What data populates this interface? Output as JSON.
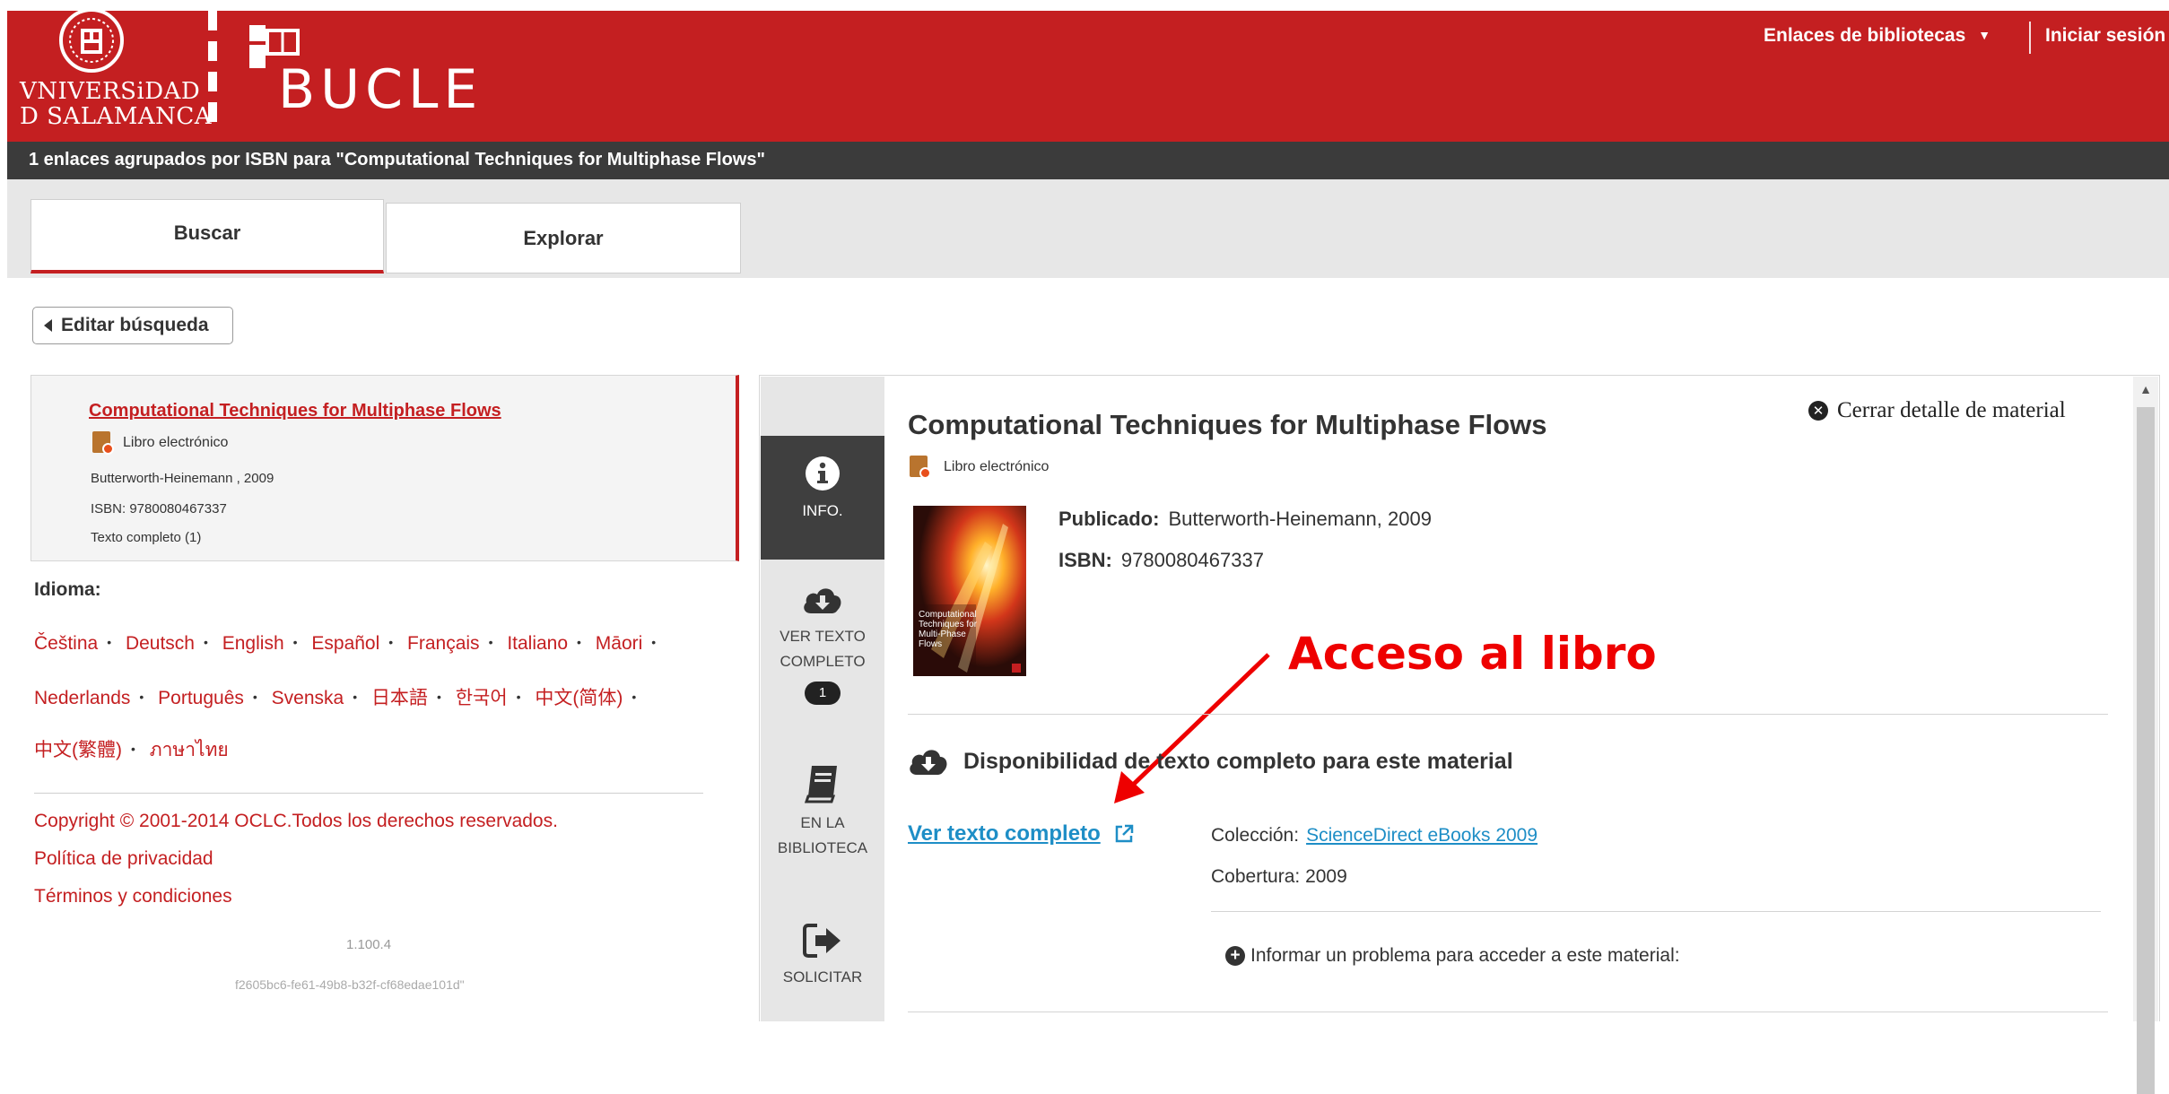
{
  "header": {
    "university_logo_text": [
      "VNIVERSiDAD",
      "D SALAMANCA"
    ],
    "app_name": "BUCLE",
    "links_menu_label": "Enlaces de bibliotecas",
    "login_label": "Iniciar sesión"
  },
  "results_bar": {
    "text": "1 enlaces agrupados por ISBN para \"Computational Techniques for Multiphase Flows\""
  },
  "tabs": [
    {
      "label": "Buscar",
      "active": true
    },
    {
      "label": "Explorar",
      "active": false
    }
  ],
  "edit_search_label": "Editar búsqueda",
  "result": {
    "title": "Computational Techniques for Multiphase Flows",
    "type": "Libro electrónico",
    "publisher": "Butterworth-Heinemann , 2009",
    "isbn": "ISBN: 9780080467337",
    "full_text": "Texto completo (1)"
  },
  "language": {
    "label": "Idioma:",
    "rows": [
      [
        "Čeština",
        "Deutsch",
        "English",
        "Español",
        "Français",
        "Italiano",
        "Māori"
      ],
      [
        "Nederlands",
        "Português",
        "Svenska",
        "日本語",
        "한국어",
        "中文(简体)"
      ],
      [
        "中文(繁體)",
        "ภาษาไทย"
      ]
    ]
  },
  "footer": {
    "copyright": "Copyright © 2001-2014 OCLC.Todos los derechos reservados.",
    "privacy": "Política de privacidad",
    "terms": "Términos y condiciones",
    "version": "1.100.4",
    "build_id": "f2605bc6-fe61-49b8-b32f-cf68edae101d\""
  },
  "detail_nav": {
    "info": "INFO.",
    "full_text_1": "VER TEXTO",
    "full_text_2": "COMPLETO",
    "full_text_count": "1",
    "library_1": "EN LA",
    "library_2": "BIBLIOTECA",
    "request": "SOLICITAR"
  },
  "detail": {
    "title": "Computational Techniques for Multiphase Flows",
    "close_label": "Cerrar detalle de material",
    "type": "Libro electrónico",
    "published_label": "Publicado:",
    "published_value": "Butterworth-Heinemann, 2009",
    "isbn_label": "ISBN:",
    "isbn_value": "9780080467337",
    "cover_text": "Computational Techniques for Multi-Phase Flows",
    "availability_heading": "Disponibilidad de texto completo para este material",
    "full_text_link": "Ver texto completo",
    "collection_label": "Colección:",
    "collection_value": "ScienceDirect eBooks 2009",
    "coverage_label": "Cobertura:",
    "coverage_value": "2009",
    "report_label": "Informar un problema para acceder a este material:"
  },
  "annotation": {
    "text": "Acceso al libro",
    "color": "#ee0000"
  },
  "colors": {
    "brand_red": "#c41f21",
    "dark_bar": "#3b3b3b",
    "link_blue": "#1e8ec6"
  },
  "icons": [
    "university-seal-icon",
    "bucle-book-icon",
    "caret-down-icon",
    "ebook-icon",
    "info-icon",
    "cloud-download-icon",
    "book-icon",
    "sign-out-icon",
    "close-circle-icon",
    "external-link-icon",
    "plus-circle-icon",
    "triangle-left-icon"
  ]
}
